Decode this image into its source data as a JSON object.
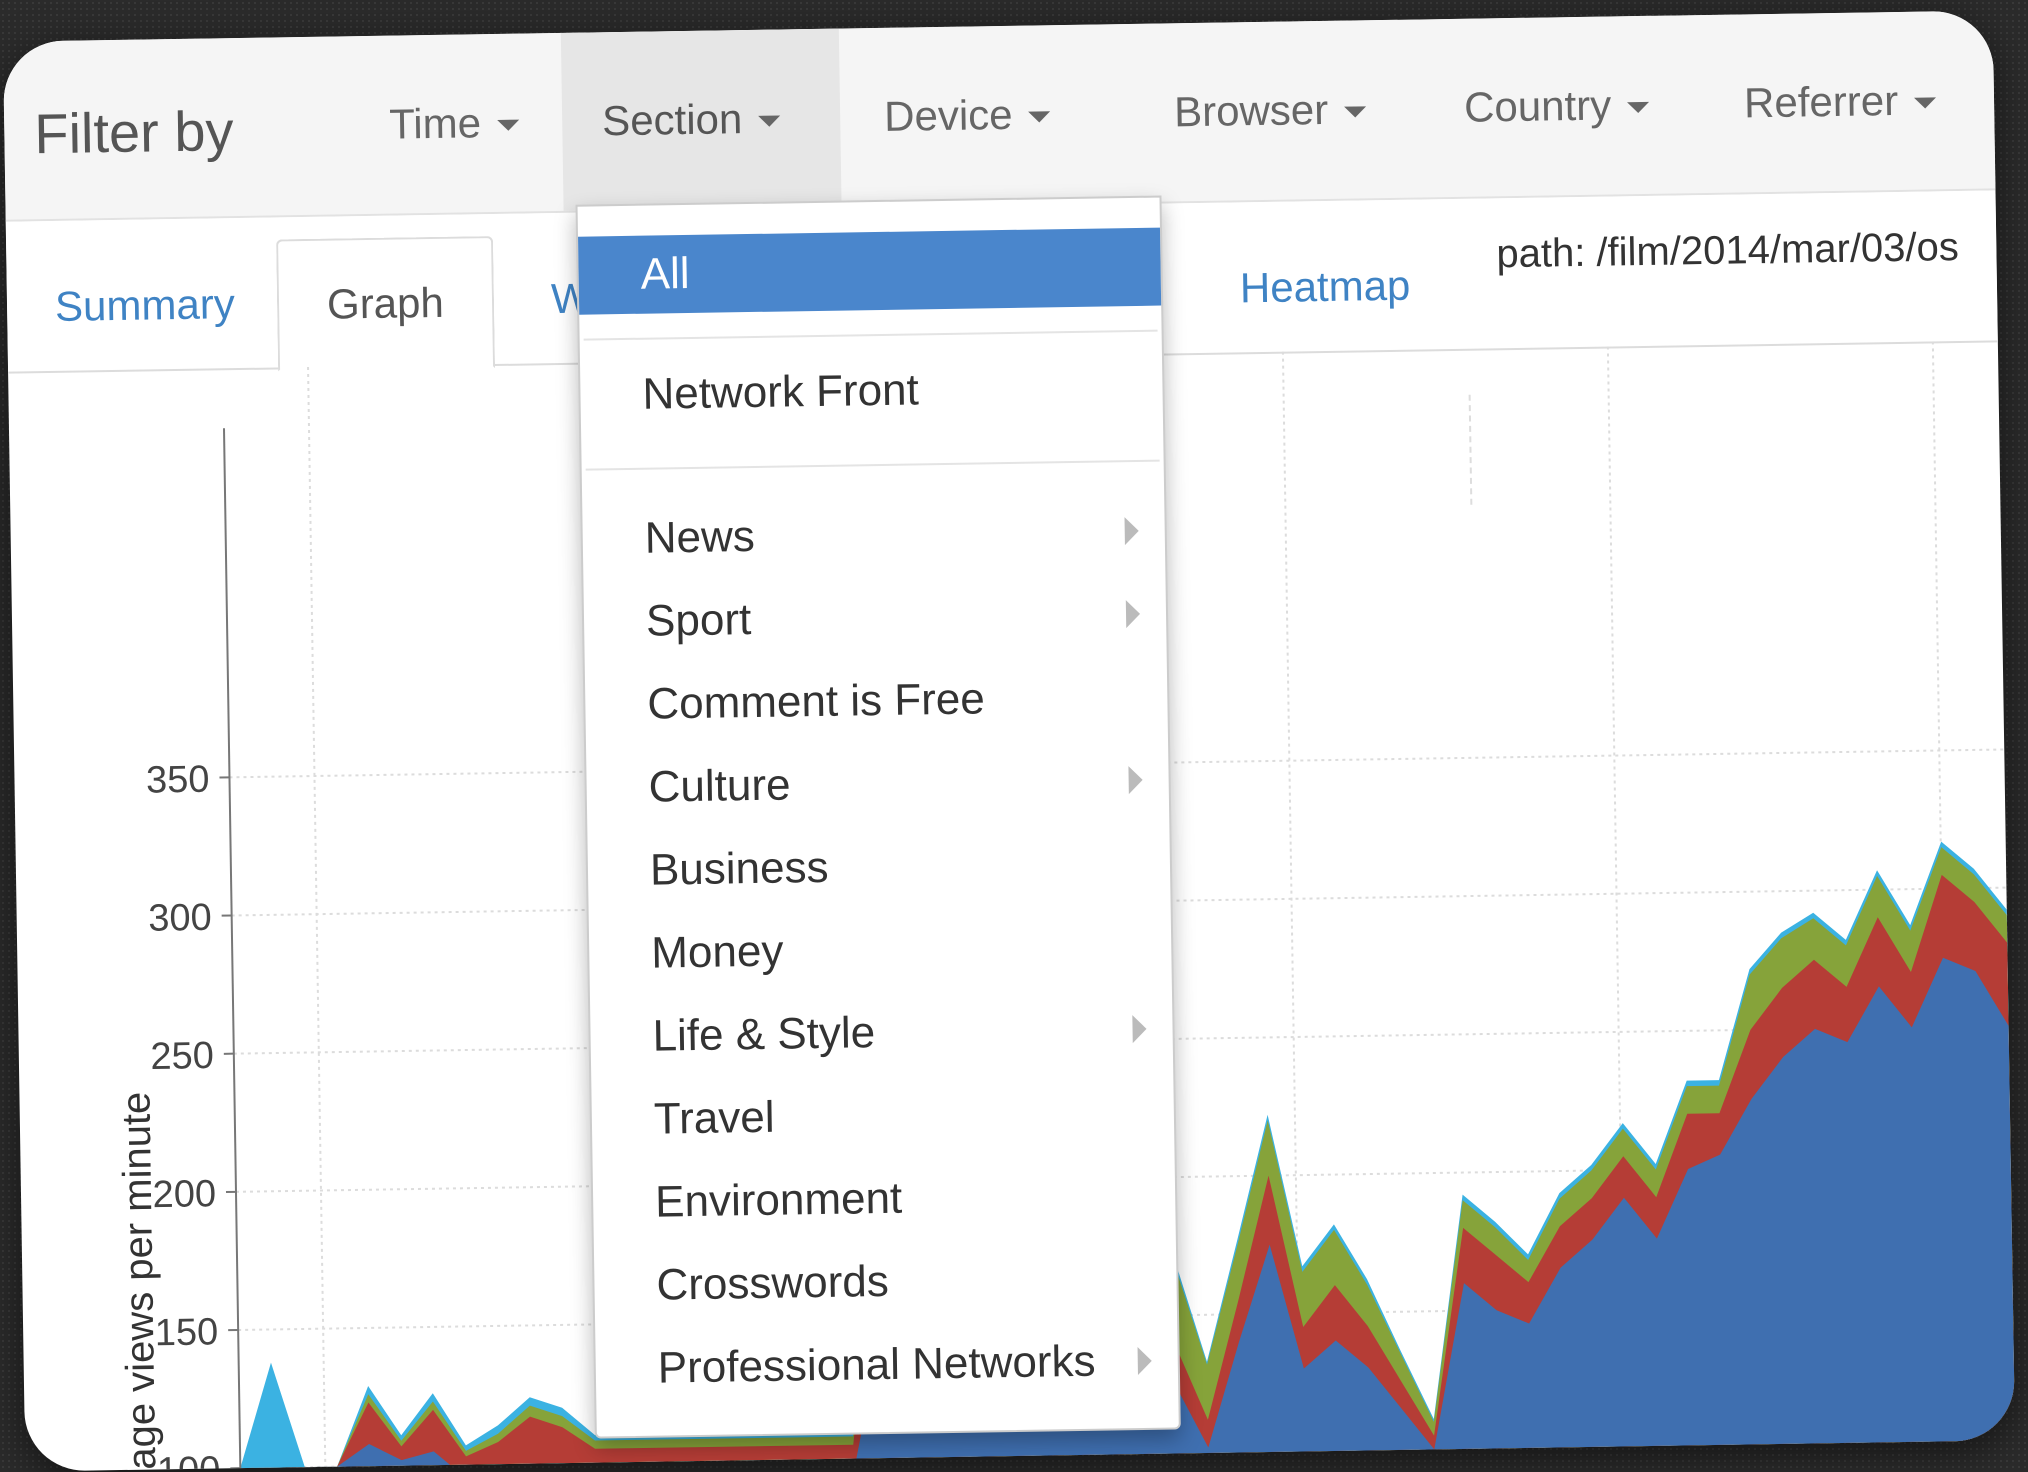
{
  "filter_bar": {
    "label": "Filter by",
    "items": [
      {
        "label": "Time"
      },
      {
        "label": "Section"
      },
      {
        "label": "Device"
      },
      {
        "label": "Browser"
      },
      {
        "label": "Country"
      },
      {
        "label": "Referrer"
      }
    ]
  },
  "tabs": [
    {
      "label": "Summary"
    },
    {
      "label": "Graph"
    },
    {
      "label": "W"
    },
    {
      "label": "Heatmap"
    }
  ],
  "path_text": "path: /film/2014/mar/03/os",
  "section_menu": {
    "items": [
      {
        "label": "All",
        "selected": true,
        "submenu": false
      },
      {
        "label": "Network Front",
        "submenu": false
      },
      {
        "label": "News",
        "submenu": true
      },
      {
        "label": "Sport",
        "submenu": true
      },
      {
        "label": "Comment is Free",
        "submenu": false
      },
      {
        "label": "Culture",
        "submenu": true
      },
      {
        "label": "Business",
        "submenu": false
      },
      {
        "label": "Money",
        "submenu": false
      },
      {
        "label": "Life & Style",
        "submenu": true
      },
      {
        "label": "Travel",
        "submenu": false
      },
      {
        "label": "Environment",
        "submenu": false
      },
      {
        "label": "Crosswords",
        "submenu": false
      },
      {
        "label": "Professional Networks",
        "submenu": true
      }
    ]
  },
  "chart_data": {
    "type": "area",
    "ylabel": "age views per minute",
    "yticks": [
      100,
      150,
      200,
      250,
      300,
      350
    ],
    "ylim": [
      100,
      375
    ],
    "grid": true,
    "colors": {
      "blue": "#3f6fb0",
      "red": "#b53d36",
      "green": "#86a33a",
      "cyan": "#3bb2e2"
    },
    "series": [
      {
        "values": [
          100,
          100,
          100,
          100,
          108,
          102,
          105,
          95,
          96,
          100,
          100,
          95,
          95,
          95,
          95,
          95,
          95,
          95,
          95,
          95,
          150,
          165,
          175,
          165,
          145,
          160,
          150,
          110,
          115,
          125,
          102,
          140,
          175,
          130,
          140,
          130,
          115,
          100,
          160,
          150,
          145,
          165,
          175,
          190,
          175,
          200,
          205,
          225,
          240,
          250,
          245,
          265,
          250,
          275,
          270,
          250
        ]
      },
      {
        "values": [
          0,
          0,
          0,
          0,
          15,
          5,
          15,
          8,
          12,
          17,
          13,
          10,
          10,
          10,
          10,
          10,
          10,
          10,
          10,
          10,
          50,
          45,
          45,
          40,
          15,
          35,
          30,
          15,
          15,
          15,
          10,
          15,
          25,
          15,
          20,
          15,
          10,
          5,
          20,
          20,
          15,
          15,
          15,
          15,
          15,
          20,
          15,
          25,
          25,
          25,
          20,
          25,
          20,
          30,
          25,
          30
        ]
      },
      {
        "values": [
          0,
          0,
          0,
          0,
          3,
          2,
          3,
          2,
          3,
          4,
          4,
          3,
          3,
          3,
          3,
          3,
          3,
          3,
          3,
          3,
          90,
          75,
          60,
          50,
          20,
          35,
          30,
          25,
          25,
          30,
          20,
          20,
          20,
          20,
          20,
          15,
          10,
          5,
          10,
          10,
          8,
          10,
          10,
          10,
          10,
          10,
          10,
          20,
          18,
          15,
          15,
          15,
          15,
          10,
          10,
          10
        ]
      },
      {
        "values": [
          0,
          38,
          0,
          0,
          3,
          2,
          3,
          2,
          3,
          3,
          3,
          2,
          2,
          2,
          2,
          2,
          2,
          2,
          2,
          2,
          5,
          4,
          4,
          3,
          2,
          2,
          2,
          2,
          2,
          2,
          1,
          2,
          2,
          2,
          2,
          2,
          1,
          1,
          2,
          2,
          2,
          2,
          2,
          2,
          2,
          2,
          2,
          2,
          2,
          2,
          2,
          2,
          2,
          2,
          2,
          2
        ]
      }
    ]
  }
}
